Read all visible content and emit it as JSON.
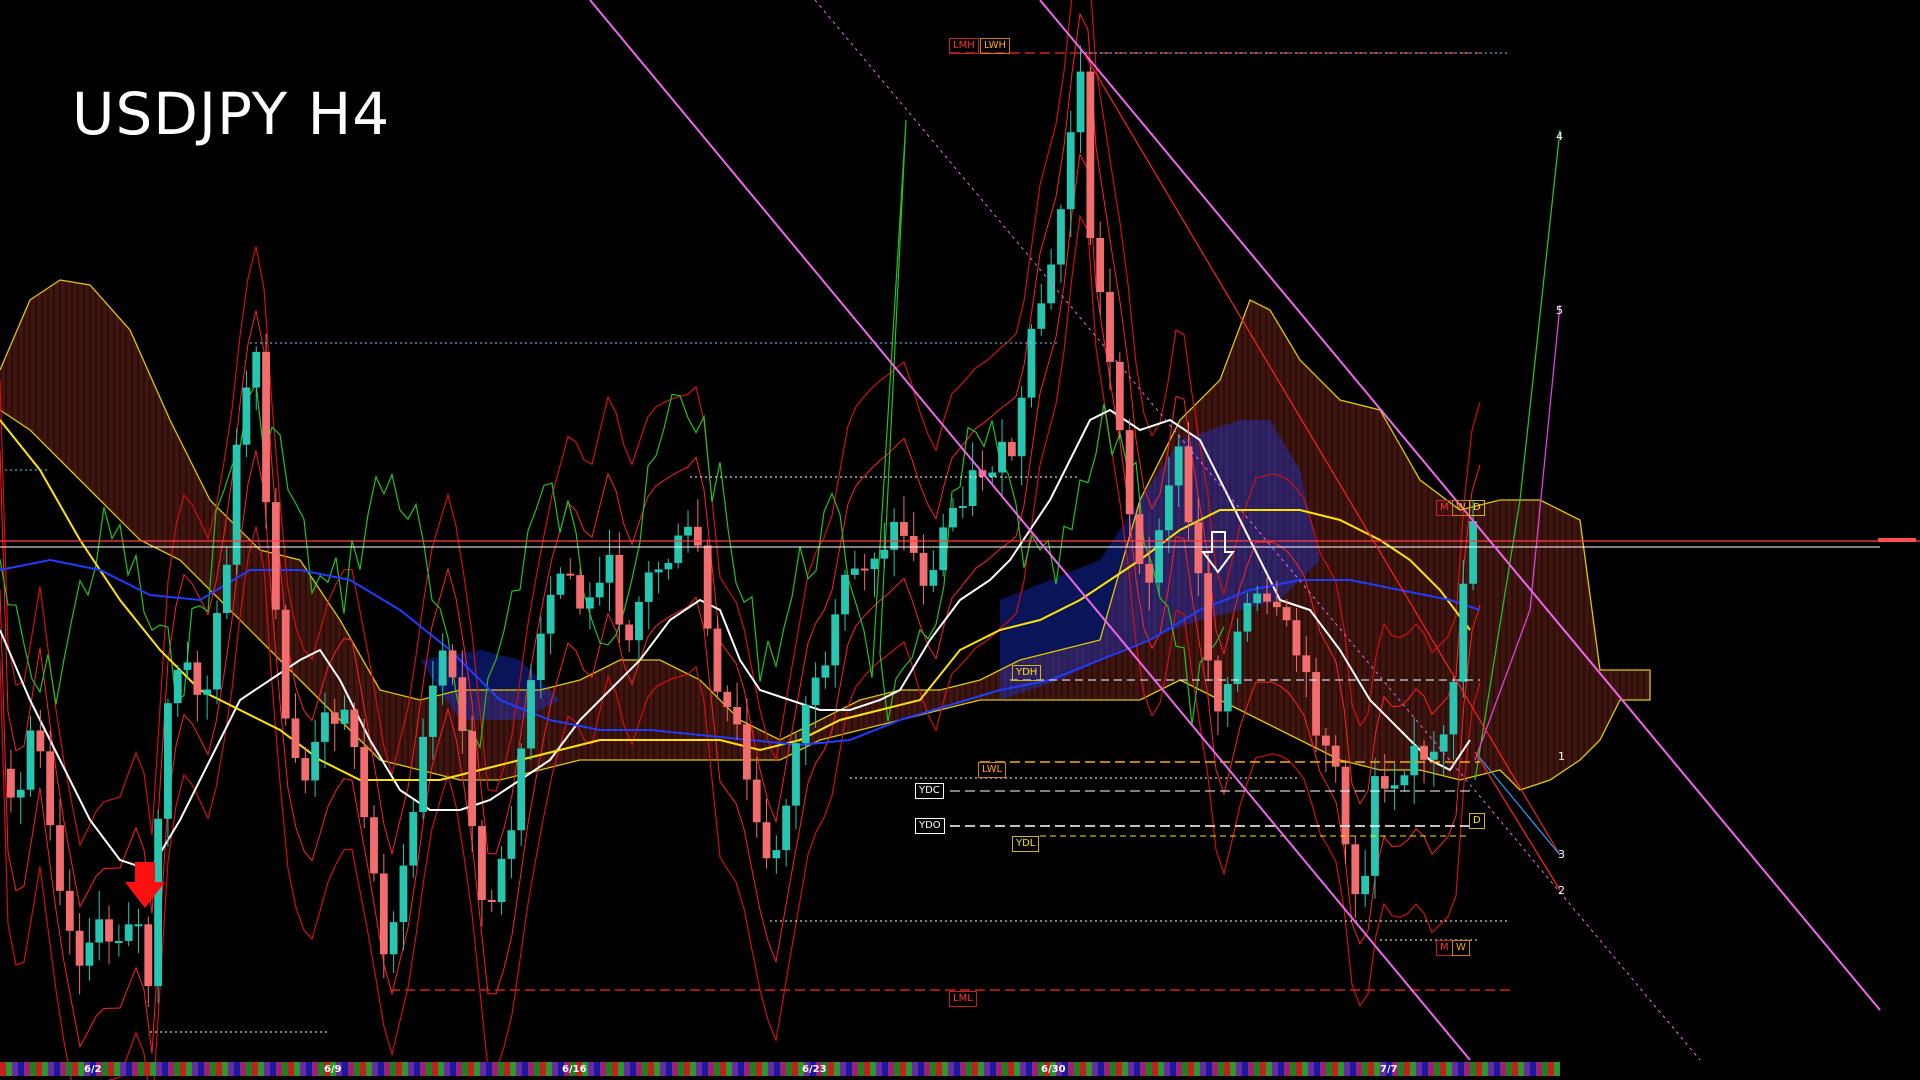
{
  "title": "USDJPY H4",
  "colors": {
    "background": "#000000",
    "bull": "#26c6b0",
    "bear": "#f26d6d",
    "white_ma": "#ffffff",
    "yellow_ma": "#ffe400",
    "blue_ma": "#1f3cff",
    "green_osc": "#22c21a",
    "magenta_channel": "#ee66ee",
    "cloud": "#b83a2a",
    "red_line": "#ff2020"
  },
  "tags": {
    "lmh": "LMH",
    "lwh": "LWH",
    "ydh": "YDH",
    "lwl": "LWL",
    "ydc": "YDC",
    "ydo": "YDO",
    "ydl": "YDL",
    "lml": "LML",
    "m_top": "M",
    "w_top": "W",
    "d_top": "D",
    "d_mid": "D",
    "m_bot": "M",
    "w_bot": "W"
  },
  "fib_levels": [
    "4",
    "5",
    "1",
    "3",
    "2"
  ],
  "chart_data": {
    "type": "candlestick",
    "symbol": "USDJPY",
    "timeframe": "H4",
    "x_labels": [
      "6/2",
      "6/9",
      "6/16",
      "6/23",
      "6/30",
      "7/7"
    ],
    "grid": false,
    "indicators": [
      "white MA",
      "yellow MA",
      "blue MA",
      "Ichimoku cloud",
      "Bollinger-style red bands",
      "green oscillator",
      "magenta descending channel"
    ],
    "candle_count": 150
  }
}
